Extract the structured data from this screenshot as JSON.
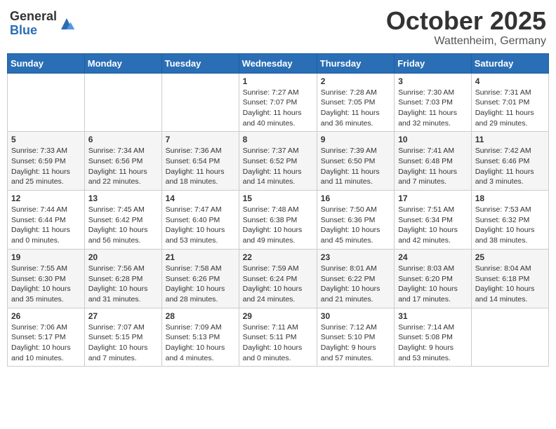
{
  "logo": {
    "general": "General",
    "blue": "Blue"
  },
  "title": {
    "month_year": "October 2025",
    "location": "Wattenheim, Germany"
  },
  "weekdays": [
    "Sunday",
    "Monday",
    "Tuesday",
    "Wednesday",
    "Thursday",
    "Friday",
    "Saturday"
  ],
  "weeks": [
    [
      {
        "day": "",
        "info": ""
      },
      {
        "day": "",
        "info": ""
      },
      {
        "day": "",
        "info": ""
      },
      {
        "day": "1",
        "info": "Sunrise: 7:27 AM\nSunset: 7:07 PM\nDaylight: 11 hours\nand 40 minutes."
      },
      {
        "day": "2",
        "info": "Sunrise: 7:28 AM\nSunset: 7:05 PM\nDaylight: 11 hours\nand 36 minutes."
      },
      {
        "day": "3",
        "info": "Sunrise: 7:30 AM\nSunset: 7:03 PM\nDaylight: 11 hours\nand 32 minutes."
      },
      {
        "day": "4",
        "info": "Sunrise: 7:31 AM\nSunset: 7:01 PM\nDaylight: 11 hours\nand 29 minutes."
      }
    ],
    [
      {
        "day": "5",
        "info": "Sunrise: 7:33 AM\nSunset: 6:59 PM\nDaylight: 11 hours\nand 25 minutes."
      },
      {
        "day": "6",
        "info": "Sunrise: 7:34 AM\nSunset: 6:56 PM\nDaylight: 11 hours\nand 22 minutes."
      },
      {
        "day": "7",
        "info": "Sunrise: 7:36 AM\nSunset: 6:54 PM\nDaylight: 11 hours\nand 18 minutes."
      },
      {
        "day": "8",
        "info": "Sunrise: 7:37 AM\nSunset: 6:52 PM\nDaylight: 11 hours\nand 14 minutes."
      },
      {
        "day": "9",
        "info": "Sunrise: 7:39 AM\nSunset: 6:50 PM\nDaylight: 11 hours\nand 11 minutes."
      },
      {
        "day": "10",
        "info": "Sunrise: 7:41 AM\nSunset: 6:48 PM\nDaylight: 11 hours\nand 7 minutes."
      },
      {
        "day": "11",
        "info": "Sunrise: 7:42 AM\nSunset: 6:46 PM\nDaylight: 11 hours\nand 3 minutes."
      }
    ],
    [
      {
        "day": "12",
        "info": "Sunrise: 7:44 AM\nSunset: 6:44 PM\nDaylight: 11 hours\nand 0 minutes."
      },
      {
        "day": "13",
        "info": "Sunrise: 7:45 AM\nSunset: 6:42 PM\nDaylight: 10 hours\nand 56 minutes."
      },
      {
        "day": "14",
        "info": "Sunrise: 7:47 AM\nSunset: 6:40 PM\nDaylight: 10 hours\nand 53 minutes."
      },
      {
        "day": "15",
        "info": "Sunrise: 7:48 AM\nSunset: 6:38 PM\nDaylight: 10 hours\nand 49 minutes."
      },
      {
        "day": "16",
        "info": "Sunrise: 7:50 AM\nSunset: 6:36 PM\nDaylight: 10 hours\nand 45 minutes."
      },
      {
        "day": "17",
        "info": "Sunrise: 7:51 AM\nSunset: 6:34 PM\nDaylight: 10 hours\nand 42 minutes."
      },
      {
        "day": "18",
        "info": "Sunrise: 7:53 AM\nSunset: 6:32 PM\nDaylight: 10 hours\nand 38 minutes."
      }
    ],
    [
      {
        "day": "19",
        "info": "Sunrise: 7:55 AM\nSunset: 6:30 PM\nDaylight: 10 hours\nand 35 minutes."
      },
      {
        "day": "20",
        "info": "Sunrise: 7:56 AM\nSunset: 6:28 PM\nDaylight: 10 hours\nand 31 minutes."
      },
      {
        "day": "21",
        "info": "Sunrise: 7:58 AM\nSunset: 6:26 PM\nDaylight: 10 hours\nand 28 minutes."
      },
      {
        "day": "22",
        "info": "Sunrise: 7:59 AM\nSunset: 6:24 PM\nDaylight: 10 hours\nand 24 minutes."
      },
      {
        "day": "23",
        "info": "Sunrise: 8:01 AM\nSunset: 6:22 PM\nDaylight: 10 hours\nand 21 minutes."
      },
      {
        "day": "24",
        "info": "Sunrise: 8:03 AM\nSunset: 6:20 PM\nDaylight: 10 hours\nand 17 minutes."
      },
      {
        "day": "25",
        "info": "Sunrise: 8:04 AM\nSunset: 6:18 PM\nDaylight: 10 hours\nand 14 minutes."
      }
    ],
    [
      {
        "day": "26",
        "info": "Sunrise: 7:06 AM\nSunset: 5:17 PM\nDaylight: 10 hours\nand 10 minutes."
      },
      {
        "day": "27",
        "info": "Sunrise: 7:07 AM\nSunset: 5:15 PM\nDaylight: 10 hours\nand 7 minutes."
      },
      {
        "day": "28",
        "info": "Sunrise: 7:09 AM\nSunset: 5:13 PM\nDaylight: 10 hours\nand 4 minutes."
      },
      {
        "day": "29",
        "info": "Sunrise: 7:11 AM\nSunset: 5:11 PM\nDaylight: 10 hours\nand 0 minutes."
      },
      {
        "day": "30",
        "info": "Sunrise: 7:12 AM\nSunset: 5:10 PM\nDaylight: 9 hours\nand 57 minutes."
      },
      {
        "day": "31",
        "info": "Sunrise: 7:14 AM\nSunset: 5:08 PM\nDaylight: 9 hours\nand 53 minutes."
      },
      {
        "day": "",
        "info": ""
      }
    ]
  ]
}
